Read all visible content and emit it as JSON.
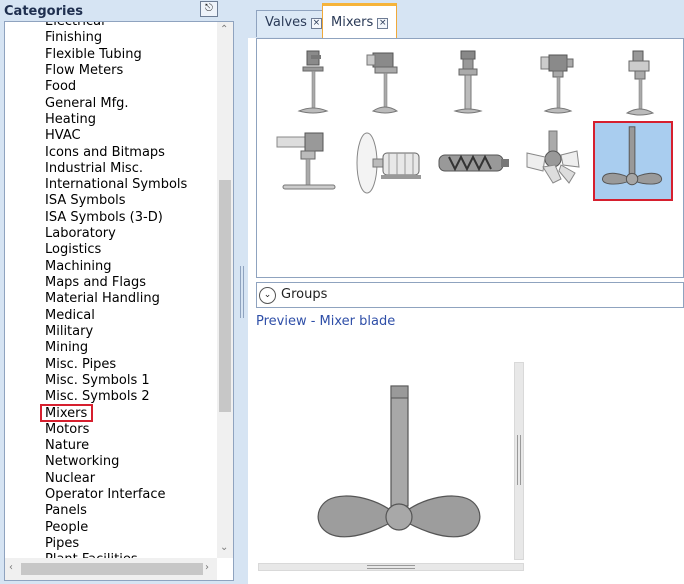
{
  "categories_panel": {
    "title": "Categories",
    "pin_icon": "pin-icon",
    "items": [
      "Electrical",
      "Finishing",
      "Flexible Tubing",
      "Flow Meters",
      "Food",
      "General Mfg.",
      "Heating",
      "HVAC",
      "Icons and Bitmaps",
      "Industrial Misc.",
      "International Symbols",
      "ISA Symbols",
      "ISA Symbols (3-D)",
      "Laboratory",
      "Logistics",
      "Machining",
      "Maps and Flags",
      "Material Handling",
      "Medical",
      "Military",
      "Mining",
      "Misc. Pipes",
      "Misc. Symbols 1",
      "Misc. Symbols 2",
      "Mixers",
      "Motors",
      "Nature",
      "Networking",
      "Nuclear",
      "Operator Interface",
      "Panels",
      "People",
      "Pipes",
      "Plant Facilities"
    ],
    "selected": "Mixers"
  },
  "tabs": [
    {
      "label": "Valves",
      "active": false
    },
    {
      "label": "Mixers",
      "active": true
    }
  ],
  "symbols": [
    {
      "name": "mixer-top-1"
    },
    {
      "name": "mixer-top-2"
    },
    {
      "name": "mixer-top-3"
    },
    {
      "name": "mixer-top-4"
    },
    {
      "name": "mixer-top-5"
    },
    {
      "name": "mixer-side-1"
    },
    {
      "name": "mixer-drum"
    },
    {
      "name": "mixer-screw"
    },
    {
      "name": "mixer-paddle"
    },
    {
      "name": "mixer-blade",
      "selected": true
    }
  ],
  "groups": {
    "label": "Groups",
    "icon": "chevron-down-circle-icon"
  },
  "preview": {
    "title": "Preview - Mixer blade"
  },
  "colors": {
    "panel_bg": "#d6e4f3",
    "selection_outline": "#d61f2e",
    "selected_fill": "#a9cdef",
    "active_tab_accent": "#f6b43a",
    "preview_title": "#2f4fa8"
  }
}
